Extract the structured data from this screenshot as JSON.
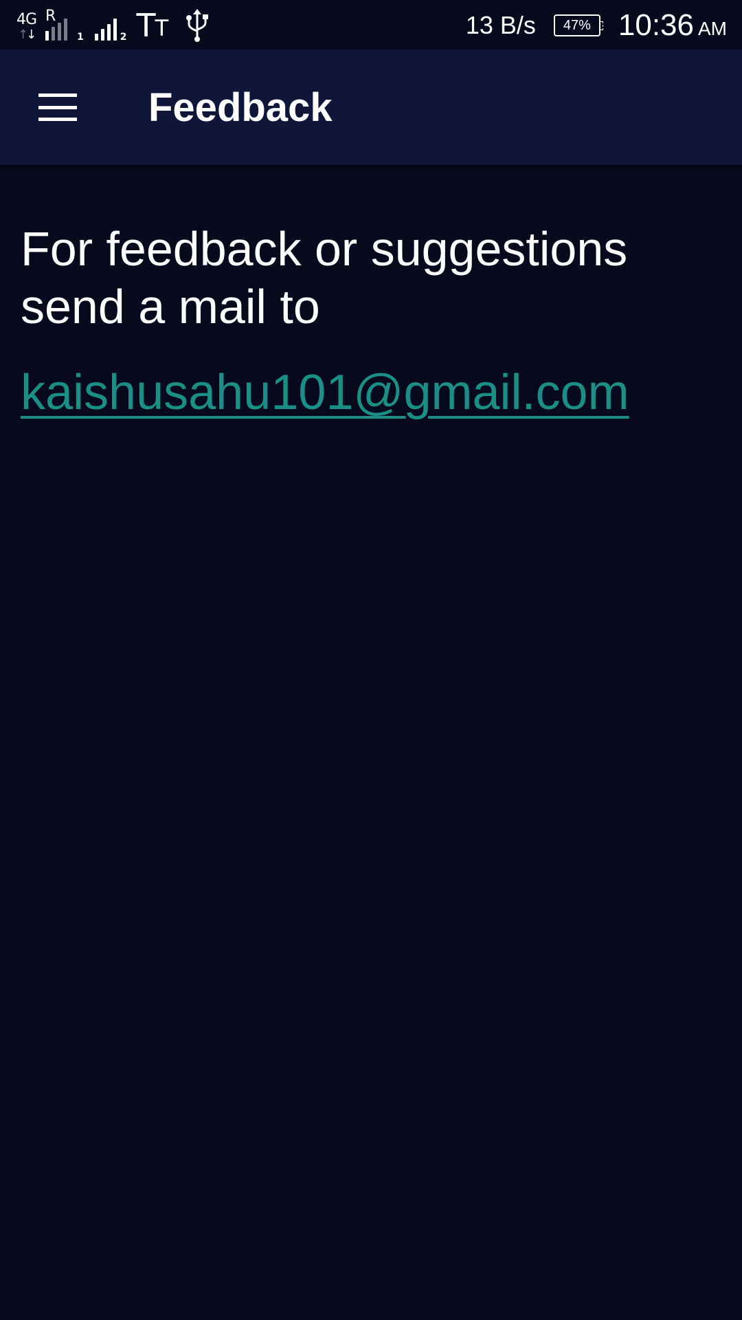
{
  "status_bar": {
    "network_type": "4G",
    "roaming": "R",
    "sim1_index": "1",
    "sim2_index": "2",
    "net_speed": "13 B/s",
    "battery_percent": "47%",
    "time": "10:36",
    "ampm": "AM",
    "icons": [
      "signal-strength-icon",
      "text-size-icon",
      "usb-icon",
      "battery-icon"
    ]
  },
  "app_bar": {
    "title": "Feedback",
    "menu_icon": "hamburger-menu-icon",
    "background_color": "#10163a"
  },
  "content": {
    "message": "For feedback or suggestions send a mail to",
    "email": "kaishusahu101@gmail.com",
    "link_color": "#1a8f86"
  },
  "colors": {
    "background": "#070a1c",
    "text": "#ffffff"
  }
}
